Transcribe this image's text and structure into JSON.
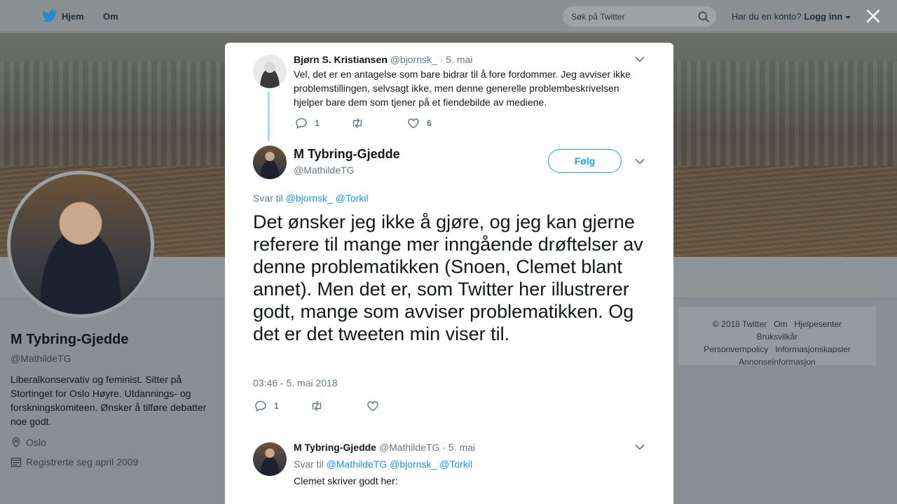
{
  "topnav": {
    "home_label": "Hjem",
    "about_label": "Om",
    "search_placeholder": "Søk på Twitter",
    "account_question": "Har du en konto?",
    "login_label": "Logg inn"
  },
  "profile": {
    "name": "M Tybring-Gjedde",
    "handle": "@MathildeTG",
    "bio": "Liberalkonservativ og feminist. Sitter på Stortinget for Oslo Høyre. Utdannings- og forskningskomiteen. Ønsker å tilføre debatter noe godt.",
    "location": "Oslo",
    "joined": "Registrerte seg april 2009"
  },
  "footer": {
    "links": [
      "© 2018 Twitter",
      "Om",
      "Hjelpesenter",
      "Bruksvilkår",
      "Personvernpolicy",
      "Informasjonskapsler",
      "Annonseinformasjon"
    ]
  },
  "modal": {
    "parent_tweet": {
      "name": "Bjørn S. Kristiansen",
      "handle": "@bjornsk_",
      "date": "· 5. mai",
      "text": "Vel, det er en antagelse som bare bidrar til å fore fordommer. Jeg avviser ikke problemstillingen, selvsagt ikke, men denne generelle problembeskrivelsen hjelper bare dem som tjener på et fiendebilde av mediene.",
      "reply_count": "1",
      "retweet_count": "",
      "like_count": "6"
    },
    "main_tweet": {
      "name": "M Tybring-Gjedde",
      "handle": "@MathildeTG",
      "follow_label": "Følg",
      "reply_prefix": "Svar til",
      "reply_to": [
        "@bjornsk_",
        "@Torkil"
      ],
      "text": "Det ønsker jeg ikke å gjøre, og jeg kan gjerne referere til mange mer inngående drøftelser av denne problematikken (Snoen, Clemet blant annet). Men det er, som Twitter her illustrerer godt, mange som avviser problematikken. Og det er det tweeten min viser til.",
      "timestamp": "03:46 - 5. mai 2018",
      "reply_count": "1",
      "retweet_count": "",
      "like_count": ""
    },
    "child_tweet": {
      "name": "M Tybring-Gjedde",
      "handle": "@MathildeTG",
      "date": "· 5. mai",
      "reply_prefix": "Svar til",
      "reply_to": [
        "@MathildeTG",
        "@bjornsk_",
        "@Torkil"
      ],
      "text": "Clemet skriver godt her:"
    }
  },
  "colors": {
    "accent": "#1da1f2",
    "link": "#1b95e0",
    "muted": "#657786",
    "thread_line": "#a6d9f4"
  }
}
